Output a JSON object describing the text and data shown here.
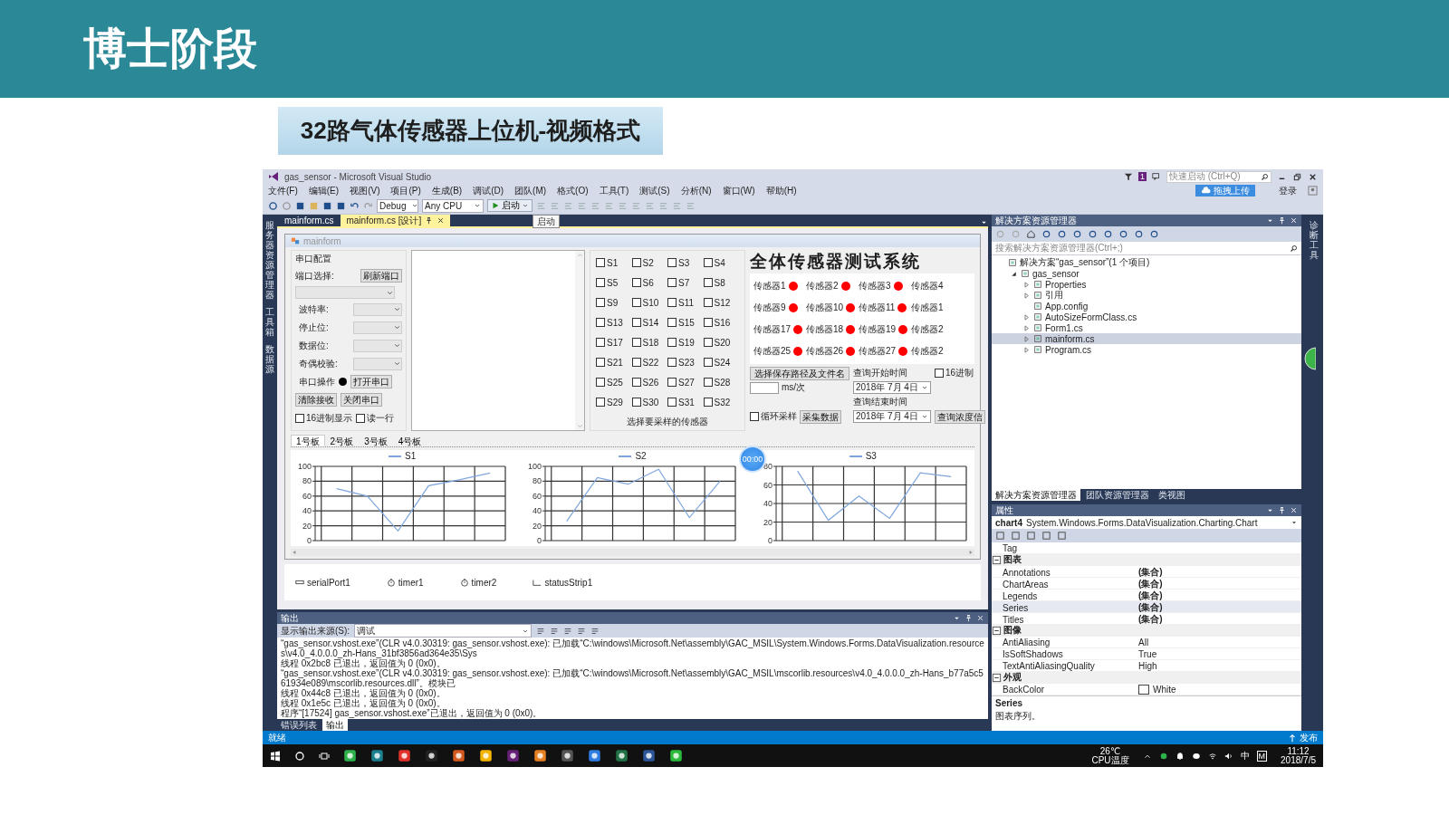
{
  "slide": {
    "title": "博士阶段",
    "subtitle": "32路气体传感器上位机-视频格式"
  },
  "window": {
    "title": "gas_sensor - Microsoft Visual Studio",
    "notification_count": "1",
    "quick_launch": {
      "placeholder": "快速启动 (Ctrl+Q)"
    }
  },
  "menu": [
    "文件(F)",
    "编辑(E)",
    "视图(V)",
    "项目(P)",
    "生成(B)",
    "调试(D)",
    "团队(M)",
    "格式(O)",
    "工具(T)",
    "测试(S)",
    "分析(N)",
    "窗口(W)",
    "帮助(H)"
  ],
  "account": {
    "upload_button": "拖拽上传",
    "login": "登录"
  },
  "toolbar": {
    "configuration": "Debug",
    "platform": "Any CPU",
    "start_button": "启动",
    "tooltip": "启动"
  },
  "left_strip": [
    "服务器资源管理器",
    "工具箱",
    "数据源"
  ],
  "document_tabs": [
    {
      "label": "mainform.cs",
      "selected": false
    },
    {
      "label": "mainform.cs [设计]",
      "selected": true
    }
  ],
  "form": {
    "title": "mainform",
    "serial": {
      "group": "串口配置",
      "port_label": "端口选择:",
      "refresh_button": "刷新端口",
      "fields": [
        {
          "label": "波特率:"
        },
        {
          "label": "停止位:"
        },
        {
          "label": "数据位:"
        },
        {
          "label": "奇偶校验:"
        }
      ],
      "op_label": "串口操作",
      "open_button": "打开串口",
      "clear_button": "清除接收",
      "close_button": "关闭串口",
      "checks": [
        {
          "label": "16进制显示",
          "checked": false
        },
        {
          "label": "读一行",
          "checked": false
        }
      ]
    },
    "channels": {
      "caption": "选择要采样的传感器",
      "items": [
        {
          "label": "S1",
          "checked": false
        },
        {
          "label": "S2",
          "checked": false
        },
        {
          "label": "S3",
          "checked": false
        },
        {
          "label": "S4",
          "checked": false
        },
        {
          "label": "S5",
          "checked": false
        },
        {
          "label": "S6",
          "checked": false
        },
        {
          "label": "S7",
          "checked": false
        },
        {
          "label": "S8",
          "checked": false
        },
        {
          "label": "S9",
          "checked": false
        },
        {
          "label": "S10",
          "checked": false
        },
        {
          "label": "S11",
          "checked": false
        },
        {
          "label": "S12",
          "checked": false
        },
        {
          "label": "S13",
          "checked": false
        },
        {
          "label": "S14",
          "checked": false
        },
        {
          "label": "S15",
          "checked": false
        },
        {
          "label": "S16",
          "checked": false
        },
        {
          "label": "S17",
          "checked": false
        },
        {
          "label": "S18",
          "checked": false
        },
        {
          "label": "S19",
          "checked": false
        },
        {
          "label": "S20",
          "checked": false
        },
        {
          "label": "S21",
          "checked": false
        },
        {
          "label": "S22",
          "checked": false
        },
        {
          "label": "S23",
          "checked": false
        },
        {
          "label": "S24",
          "checked": false
        },
        {
          "label": "S25",
          "checked": false
        },
        {
          "label": "S26",
          "checked": false
        },
        {
          "label": "S27",
          "checked": false
        },
        {
          "label": "S28",
          "checked": false
        },
        {
          "label": "S29",
          "checked": false
        },
        {
          "label": "S30",
          "checked": false
        },
        {
          "label": "S31",
          "checked": false
        },
        {
          "label": "S32",
          "checked": false
        }
      ]
    },
    "system_title": "全体传感器测试系统",
    "sensors": [
      {
        "label": "传感器1",
        "kind": "indicator"
      },
      {
        "label": "传感器2",
        "kind": "indicator"
      },
      {
        "label": "传感器3",
        "kind": "indicator"
      },
      {
        "label": "传感器4",
        "kind": "label"
      },
      {
        "label": "传感器9",
        "kind": "indicator"
      },
      {
        "label": "传感器10",
        "kind": "indicator"
      },
      {
        "label": "传感器11",
        "kind": "indicator"
      },
      {
        "label": "传感器1",
        "kind": "label"
      },
      {
        "label": "传感器17",
        "kind": "indicator"
      },
      {
        "label": "传感器18",
        "kind": "indicator"
      },
      {
        "label": "传感器19",
        "kind": "indicator"
      },
      {
        "label": "传感器2",
        "kind": "label"
      },
      {
        "label": "传感器25",
        "kind": "indicator"
      },
      {
        "label": "传感器26",
        "kind": "indicator"
      },
      {
        "label": "传感器27",
        "kind": "indicator"
      },
      {
        "label": "传感器2",
        "kind": "label"
      }
    ],
    "capture": {
      "path_button": "选择保存路径及文件名",
      "start_label": "查询开始时间",
      "hex_check": {
        "label": "16进制",
        "checked": false
      },
      "interval_unit": "ms/次",
      "start_date": "2018年 7月 4日",
      "end_label": "查询结束时间",
      "loop_check": {
        "label": "循环采样",
        "checked": false
      },
      "collect_button": "采集数据",
      "end_date": "2018年 7月 4日",
      "query_button": "查询浓度信"
    },
    "tabs": [
      {
        "label": "1号板",
        "selected": true
      },
      {
        "label": "2号板",
        "selected": false
      },
      {
        "label": "3号板",
        "selected": false
      },
      {
        "label": "4号板",
        "selected": false
      }
    ],
    "charts": [
      {
        "chart_data": {
          "type": "line",
          "grid": true,
          "categories": [
            null,
            null,
            null,
            null,
            null,
            null
          ],
          "ylim": [
            0,
            100
          ],
          "yticks": [
            0,
            20,
            40,
            60,
            80,
            100
          ],
          "series": [
            {
              "name": "S1",
              "color": "#7ea6dc",
              "values": [
                70,
                60,
                13,
                74,
                82,
                91
              ]
            }
          ]
        }
      },
      {
        "chart_data": {
          "type": "line",
          "grid": true,
          "categories": [
            null,
            null,
            null,
            null,
            null,
            null
          ],
          "ylim": [
            0,
            100
          ],
          "yticks": [
            0,
            20,
            40,
            60,
            80,
            100
          ],
          "series": [
            {
              "name": "S2",
              "color": "#7ea6dc",
              "values": [
                26,
                85,
                76,
                96,
                31,
                80
              ]
            }
          ]
        }
      },
      {
        "chart_data": {
          "type": "line",
          "grid": true,
          "categories": [
            null,
            null,
            null,
            null,
            null,
            null
          ],
          "ylim": [
            0,
            80
          ],
          "yticks": [
            0,
            20,
            40,
            60,
            80
          ],
          "series": [
            {
              "name": "S3",
              "color": "#7ea6dc",
              "values": [
                75,
                22,
                48,
                24,
                73,
                69
              ]
            }
          ]
        }
      }
    ]
  },
  "recorder_badge": "00:00",
  "component_tray": [
    "serialPort1",
    "timer1",
    "timer2",
    "statusStrip1"
  ],
  "output": {
    "title": "输出",
    "source_label": "显示输出来源(S):",
    "source": "调试",
    "lines": [
      "“gas_sensor.vshost.exe”(CLR v4.0.30319: gas_sensor.vshost.exe): 已加载“C:\\windows\\Microsoft.Net\\assembly\\GAC_MSIL\\System.Windows.Forms.DataVisualization.resources\\v4.0_4.0.0.0_zh-Hans_31bf3856ad364e35\\Sys",
      "线程 0x2bc8 已退出，返回值为 0 (0x0)。",
      "“gas_sensor.vshost.exe”(CLR v4.0.30319: gas_sensor.vshost.exe): 已加载“C:\\windows\\Microsoft.Net\\assembly\\GAC_MSIL\\mscorlib.resources\\v4.0_4.0.0.0_zh-Hans_b77a5c561934e089\\mscorlib.resources.dll”。模块已",
      "线程 0x44c8 已退出，返回值为 0 (0x0)。",
      "线程 0x1e5c 已退出，返回值为 0 (0x0)。",
      "程序“[17524] gas_sensor.vshost.exe”已退出，返回值为 0 (0x0)。"
    ],
    "tabs": [
      {
        "label": "错误列表",
        "selected": false
      },
      {
        "label": "输出",
        "selected": true
      }
    ]
  },
  "solution_explorer": {
    "title": "解决方案资源管理器",
    "search": {
      "placeholder": "搜索解决方案资源管理器(Ctrl+;)"
    },
    "tree": [
      {
        "label": "解决方案“gas_sensor”(1 个项目)",
        "selected": false,
        "children": [
          {
            "label": "gas_sensor",
            "selected": false,
            "expanded": true,
            "children": [
              {
                "label": "Properties",
                "selected": false,
                "expanded": false
              },
              {
                "label": "引用",
                "selected": false,
                "expanded": false
              },
              {
                "label": "App.config",
                "selected": false
              },
              {
                "label": "AutoSizeFormClass.cs",
                "selected": false,
                "expanded": false
              },
              {
                "label": "Form1.cs",
                "selected": false,
                "expanded": false
              },
              {
                "label": "mainform.cs",
                "selected": true,
                "expanded": false
              },
              {
                "label": "Program.cs",
                "selected": false,
                "expanded": false
              }
            ]
          }
        ]
      }
    ],
    "tabs": [
      {
        "label": "解决方案资源管理器",
        "selected": true
      },
      {
        "label": "团队资源管理器",
        "selected": false
      },
      {
        "label": "类视图",
        "selected": false
      }
    ]
  },
  "properties": {
    "title": "属性",
    "object_name": "chart4",
    "object_type": "System.Windows.Forms.DataVisualization.Charting.Chart",
    "rows": [
      {
        "kind": "property",
        "name": "Tag",
        "selected": false
      },
      {
        "kind": "category",
        "name": "图表",
        "expanded": true
      },
      {
        "kind": "property",
        "name": "Annotations",
        "value": "(集合)",
        "selected": false
      },
      {
        "kind": "property",
        "name": "ChartAreas",
        "value": "(集合)",
        "selected": false
      },
      {
        "kind": "property",
        "name": "Legends",
        "value": "(集合)",
        "selected": false
      },
      {
        "kind": "property",
        "name": "Series",
        "value": "(集合)",
        "selected": true
      },
      {
        "kind": "property",
        "name": "Titles",
        "value": "(集合)",
        "selected": false
      },
      {
        "kind": "category",
        "name": "图像",
        "expanded": true
      },
      {
        "kind": "property",
        "name": "AntiAliasing",
        "value": "All",
        "selected": false
      },
      {
        "kind": "property",
        "name": "IsSoftShadows",
        "value": "True",
        "selected": false
      },
      {
        "kind": "property",
        "name": "TextAntiAliasingQuality",
        "value": "High",
        "selected": false
      },
      {
        "kind": "category",
        "name": "外观",
        "expanded": true
      },
      {
        "kind": "color_property",
        "name": "BackColor",
        "value": "White",
        "selected": false
      }
    ],
    "description_title": "Series",
    "description": "图表序列。"
  },
  "right_strip": [
    "诊断工具"
  ],
  "status_bar": {
    "left": "就绪",
    "right": "发布"
  },
  "taskbar": {
    "temperature": "26℃",
    "temperature_label": "CPU温度",
    "ime": "中",
    "tray_letter": "M",
    "time": "11:12",
    "date": "2018/7/5"
  }
}
